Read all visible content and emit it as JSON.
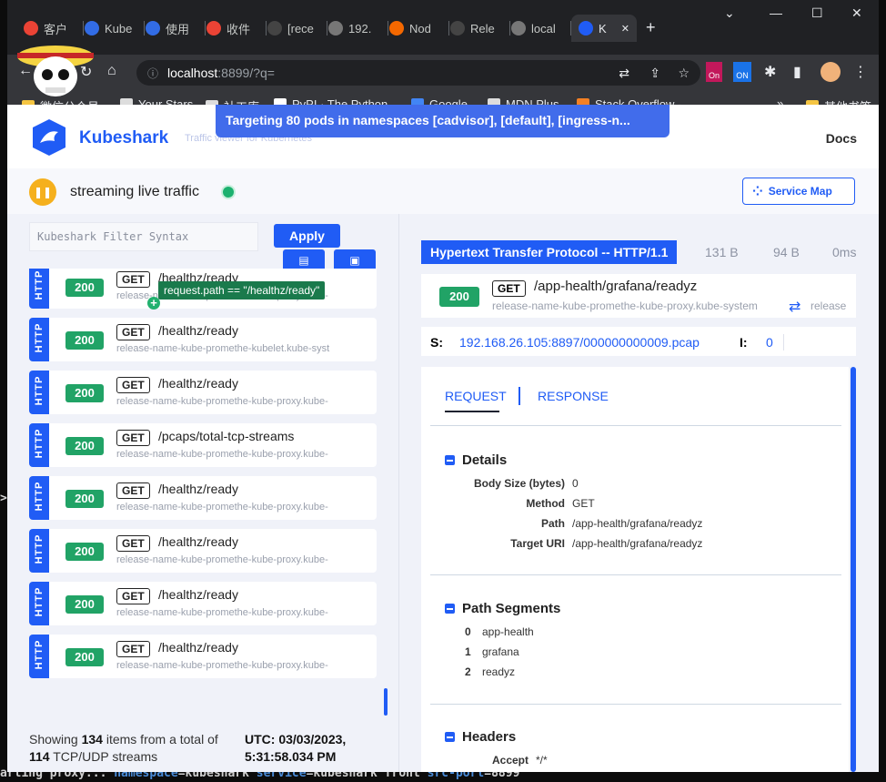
{
  "terminal": {
    "bottom_prefix": "arting proxy... ",
    "bottom_kw1": "namespace",
    "bottom_mid": "=kubeshark ",
    "bottom_kw2": "service",
    "bottom_mid2": "=kubeshark front ",
    "bottom_kw3": "src-port",
    "bottom_end": "=8899"
  },
  "browser": {
    "tabs": [
      {
        "label": "客户",
        "icon": "gmail-icon",
        "color": "#ea4335"
      },
      {
        "label": "Kube",
        "icon": "kubernetes-icon",
        "color": "#326ce5"
      },
      {
        "label": "使用",
        "icon": "kubernetes-icon",
        "color": "#326ce5"
      },
      {
        "label": "收件",
        "icon": "gmail-icon",
        "color": "#ea4335"
      },
      {
        "label": "[rece",
        "icon": "github-icon",
        "color": "#444"
      },
      {
        "label": "192.",
        "icon": "globe-icon",
        "color": "#777"
      },
      {
        "label": "Nod",
        "icon": "grafana-icon",
        "color": "#f46800"
      },
      {
        "label": "Rele",
        "icon": "github-icon",
        "color": "#444"
      },
      {
        "label": "local",
        "icon": "globe-icon",
        "color": "#777"
      },
      {
        "label": "K",
        "icon": "kubeshark-icon",
        "color": "#205cf5"
      }
    ],
    "url_host": "localhost",
    "url_rest": ":8899/?q=",
    "bookmarks": [
      {
        "label": "微信公众号",
        "icon": "wechat-icon"
      },
      {
        "label": "Your Stars",
        "icon": "github-icon"
      },
      {
        "label": "社工库",
        "icon": "globe-icon"
      },
      {
        "label": "PyPI · The Python...",
        "icon": "pypi-icon"
      },
      {
        "label": "Google",
        "icon": "google-icon"
      },
      {
        "label": "MDN Plus",
        "icon": "mdn-icon"
      },
      {
        "label": "Stack Overflow -...",
        "icon": "stackoverflow-icon"
      },
      {
        "label": "其他书签",
        "icon": "folder-icon"
      }
    ],
    "ext_on": "ON",
    "ext_on2": "On"
  },
  "app": {
    "brand": "Kubeshark",
    "tagline": "Traffic viewer for Kubernetes",
    "docs": "Docs",
    "targeting": "Targeting 80 pods in namespaces [cadvisor], [default], [ingress-n...",
    "streaming": "streaming live traffic",
    "service_map": "Service Map",
    "filter_placeholder": "Kubeshark Filter Syntax",
    "apply": "Apply",
    "tooltip": "request.path == \"/healthz/ready\""
  },
  "entries": [
    {
      "protocol": "HTTP",
      "status": "200",
      "method": "GET",
      "path": "/healthz/ready",
      "service": "release-name-kube-promethe-kube-proxy.kube-"
    },
    {
      "protocol": "HTTP",
      "status": "200",
      "method": "GET",
      "path": "/healthz/ready",
      "service": "release-name-kube-promethe-kubelet.kube-syst"
    },
    {
      "protocol": "HTTP",
      "status": "200",
      "method": "GET",
      "path": "/healthz/ready",
      "service": "release-name-kube-promethe-kube-proxy.kube-"
    },
    {
      "protocol": "HTTP",
      "status": "200",
      "method": "GET",
      "path": "/pcaps/total-tcp-streams",
      "service": "release-name-kube-promethe-kube-proxy.kube-"
    },
    {
      "protocol": "HTTP",
      "status": "200",
      "method": "GET",
      "path": "/healthz/ready",
      "service": "release-name-kube-promethe-kube-proxy.kube-"
    },
    {
      "protocol": "HTTP",
      "status": "200",
      "method": "GET",
      "path": "/healthz/ready",
      "service": "release-name-kube-promethe-kube-proxy.kube-"
    },
    {
      "protocol": "HTTP",
      "status": "200",
      "method": "GET",
      "path": "/healthz/ready",
      "service": "release-name-kube-promethe-kube-proxy.kube-"
    },
    {
      "protocol": "HTTP",
      "status": "200",
      "method": "GET",
      "path": "/healthz/ready",
      "service": "release-name-kube-promethe-kube-proxy.kube-"
    }
  ],
  "footer": {
    "showing": "Showing ",
    "items": "134",
    "items_suffix": " items from a total of",
    "streams": "114",
    "streams_suffix": " TCP/UDP streams",
    "utc_line1": "UTC: 03/03/2023,",
    "utc_line2": "5:31:58.034 PM"
  },
  "detail": {
    "protocol": "Hypertext Transfer Protocol -- HTTP/1.1",
    "req_size": "131 B",
    "resp_size": "94 B",
    "elapsed": "0ms",
    "status": "200",
    "method": "GET",
    "path": "/app-health/grafana/readyz",
    "service": "release-name-kube-promethe-kube-proxy.kube-system",
    "release": "release",
    "src_label": "S:",
    "src_value": "192.168.26.105:8897/000000000009.pcap",
    "idx_label": "I:",
    "idx_value": "0",
    "tab_request": "REQUEST",
    "tab_response": "RESPONSE",
    "details_title": "Details",
    "details": [
      {
        "key": "Body Size (bytes)",
        "value": "0"
      },
      {
        "key": "Method",
        "value": "GET"
      },
      {
        "key": "Path",
        "value": "/app-health/grafana/readyz"
      },
      {
        "key": "Target URI",
        "value": "/app-health/grafana/readyz"
      }
    ],
    "segments_title": "Path Segments",
    "segments": [
      {
        "index": "0",
        "value": "app-health"
      },
      {
        "index": "1",
        "value": "grafana"
      },
      {
        "index": "2",
        "value": "readyz"
      }
    ],
    "headers_title": "Headers",
    "headers": [
      {
        "key": "Accept",
        "value": "*/*"
      }
    ]
  }
}
